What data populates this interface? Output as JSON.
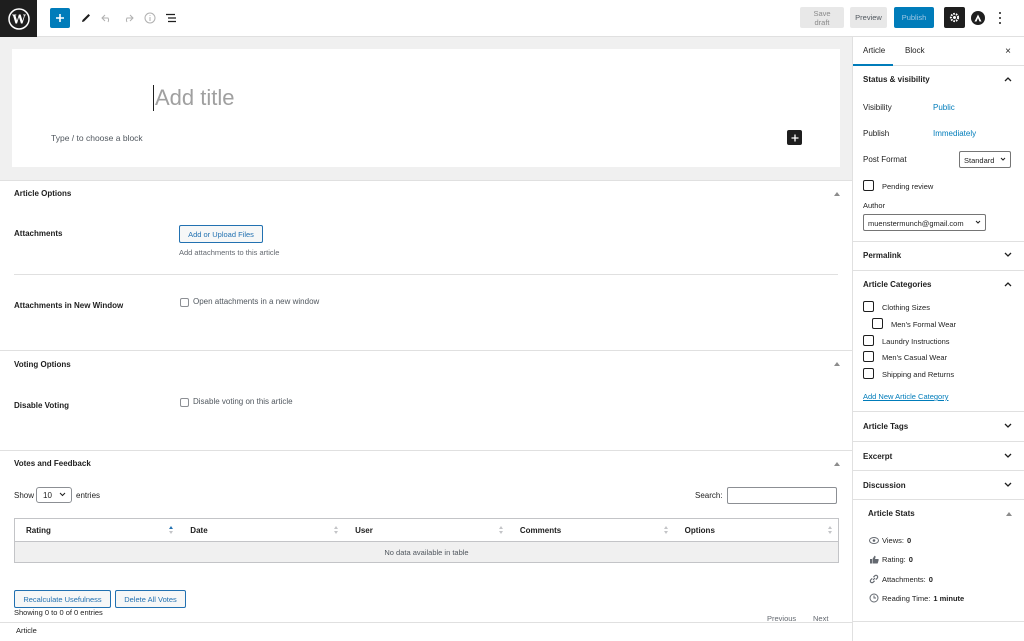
{
  "toolbar": {
    "save_draft": "Save draft",
    "preview": "Preview",
    "publish": "Publish"
  },
  "editor": {
    "title_placeholder": "Add title",
    "block_placeholder": "Type / to choose a block"
  },
  "article_options": {
    "title": "Article Options",
    "attachments_label": "Attachments",
    "upload_button": "Add or Upload Files",
    "upload_help": "Add attachments to this article",
    "new_window_label": "Attachments in New Window",
    "new_window_checkbox": "Open attachments in a new window"
  },
  "voting_options": {
    "title": "Voting Options",
    "disable_label": "Disable Voting",
    "disable_checkbox": "Disable voting on this article"
  },
  "votes_feedback": {
    "title": "Votes and Feedback",
    "show": "Show",
    "entries_value": "10",
    "entries": "entries",
    "search_label": "Search:",
    "columns": [
      "Rating",
      "Date",
      "User",
      "Comments",
      "Options"
    ],
    "empty_message": "No data available in table",
    "info": "Showing 0 to 0 of 0 entries",
    "previous": "Previous",
    "next": "Next",
    "recalc_button": "Recalculate Usefulness",
    "delete_button": "Delete All Votes"
  },
  "breadcrumb": "Article",
  "sidebar": {
    "tabs": [
      "Article",
      "Block"
    ],
    "close": "×",
    "status": {
      "title": "Status & visibility",
      "visibility_label": "Visibility",
      "visibility_value": "Public",
      "publish_label": "Publish",
      "publish_value": "Immediately",
      "format_label": "Post Format",
      "format_value": "Standard",
      "pending_review": "Pending review",
      "author_label": "Author",
      "author_value": "muenstermunch@gmail.com"
    },
    "permalink": "Permalink",
    "categories": {
      "title": "Article Categories",
      "items": [
        "Clothing Sizes",
        "Men's Formal Wear",
        "Laundry Instructions",
        "Men's Casual Wear",
        "Shipping and Returns"
      ],
      "add_new": "Add New Article Category"
    },
    "tags": "Article Tags",
    "excerpt": "Excerpt",
    "discussion": "Discussion",
    "stats": {
      "title": "Article Stats",
      "views_label": "Views:",
      "views_value": "0",
      "rating_label": "Rating:",
      "rating_value": "0",
      "attachments_label": "Attachments:",
      "attachments_value": "0",
      "reading_label": "Reading Time:",
      "reading_value": "1 minute"
    }
  },
  "colors": {
    "accent": "#007cba",
    "dark": "#1e1e1e",
    "border": "#e0e0e0"
  }
}
